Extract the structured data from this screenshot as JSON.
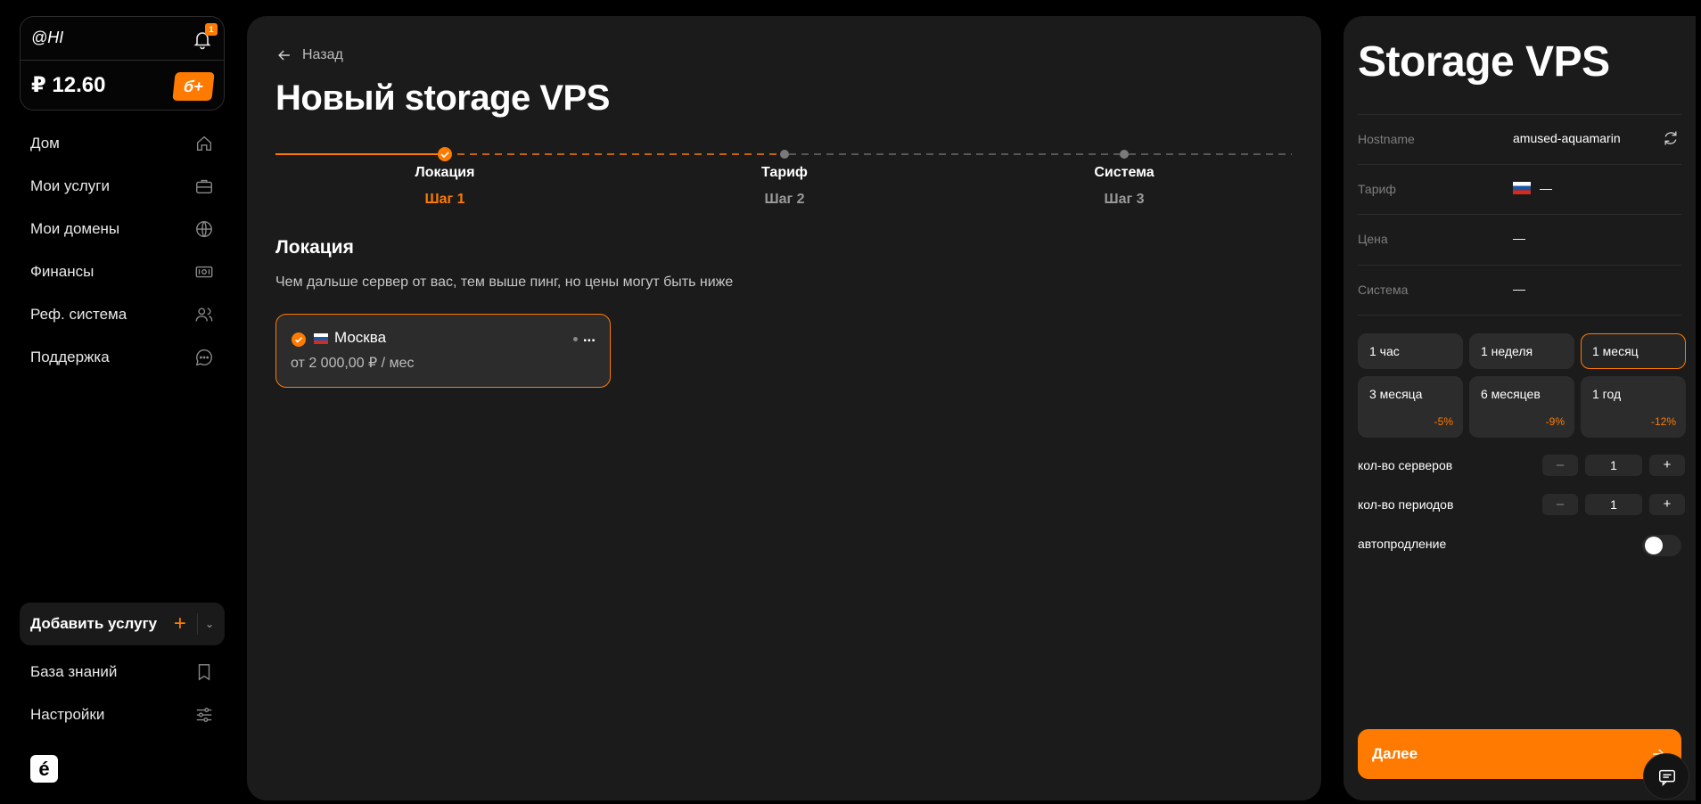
{
  "account": {
    "username": "@HI",
    "notifications_count": "1",
    "balance": "₽ 12.60",
    "bonus_label": "б+"
  },
  "nav": {
    "items": [
      {
        "label": "Дом",
        "icon": "home-icon"
      },
      {
        "label": "Мои услуги",
        "icon": "briefcase-icon"
      },
      {
        "label": "Мои домены",
        "icon": "globe-icon"
      },
      {
        "label": "Финансы",
        "icon": "cash-icon"
      },
      {
        "label": "Реф. система",
        "icon": "users-icon"
      },
      {
        "label": "Поддержка",
        "icon": "chat-bubble-icon"
      }
    ],
    "add_service": "Добавить услугу",
    "add_plus": "+",
    "bottom": [
      {
        "label": "База знаний",
        "icon": "bookmark-icon"
      },
      {
        "label": "Настройки",
        "icon": "sliders-icon"
      }
    ],
    "logo": "é"
  },
  "main": {
    "back_label": "Назад",
    "title": "Новый storage VPS",
    "steps": [
      {
        "label": "Локация",
        "sub": "Шаг 1",
        "state": "done"
      },
      {
        "label": "Тариф",
        "sub": "Шаг 2",
        "state": "pending"
      },
      {
        "label": "Система",
        "sub": "Шаг 3",
        "state": "pending"
      }
    ],
    "section_title": "Локация",
    "section_desc": "Чем дальше сервер от вас, тем выше пинг, но цены могут быть ниже",
    "location": {
      "name": "Москва",
      "flag": "ru-flag",
      "more": "...",
      "price": "от 2 000,00 ₽ / мес"
    }
  },
  "summary": {
    "title": "Storage VPS",
    "rows": [
      {
        "key": "Hostname",
        "value": "amused-aquamarin"
      },
      {
        "key": "Тариф",
        "value": "—"
      },
      {
        "key": "Цена",
        "value": "—"
      },
      {
        "key": "Система",
        "value": "—"
      }
    ],
    "periods": [
      {
        "label": "1 час",
        "discount": ""
      },
      {
        "label": "1 неделя",
        "discount": ""
      },
      {
        "label": "1 месяц",
        "discount": "",
        "selected": true
      },
      {
        "label": "3 месяца",
        "discount": "-5%"
      },
      {
        "label": "6 месяцев",
        "discount": "-9%"
      },
      {
        "label": "1 год",
        "discount": "-12%"
      }
    ],
    "servers_label": "кол-во серверов",
    "servers_value": "1",
    "periods_label": "кол-во периодов",
    "periods_value": "1",
    "minus": "–",
    "plus": "+",
    "autorenew_label": "автопродление",
    "autorenew_on": false,
    "next_label": "Далее"
  },
  "colors": {
    "accent": "#ff7a00",
    "panel": "#1b1b1b",
    "background": "#000000"
  }
}
